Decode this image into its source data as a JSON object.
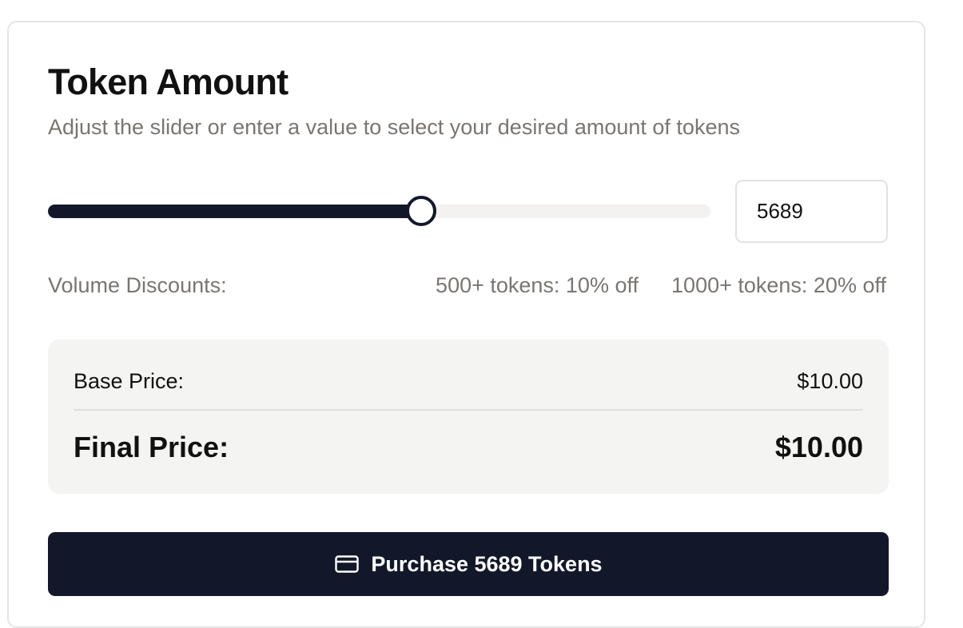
{
  "token_amount": {
    "title": "Token Amount",
    "subtitle": "Adjust the slider or enter a value to select your desired amount of tokens"
  },
  "slider": {
    "level_fraction": 0.563,
    "accent_color": "#121829",
    "track_color": "#f3f2f0"
  },
  "amount_input": {
    "value": "5689"
  },
  "discounts": {
    "label": "Volume Discounts:",
    "tier_1": "500+ tokens: 10% off",
    "tier_2": "1000+ tokens: 20% off"
  },
  "pricing": {
    "base_label": "Base Price:",
    "base_value": "$10.00",
    "final_label": "Final Price:",
    "final_value": "$10.00"
  },
  "purchase": {
    "icon": "credit-card-icon",
    "label": "Purchase 5689 Tokens"
  }
}
